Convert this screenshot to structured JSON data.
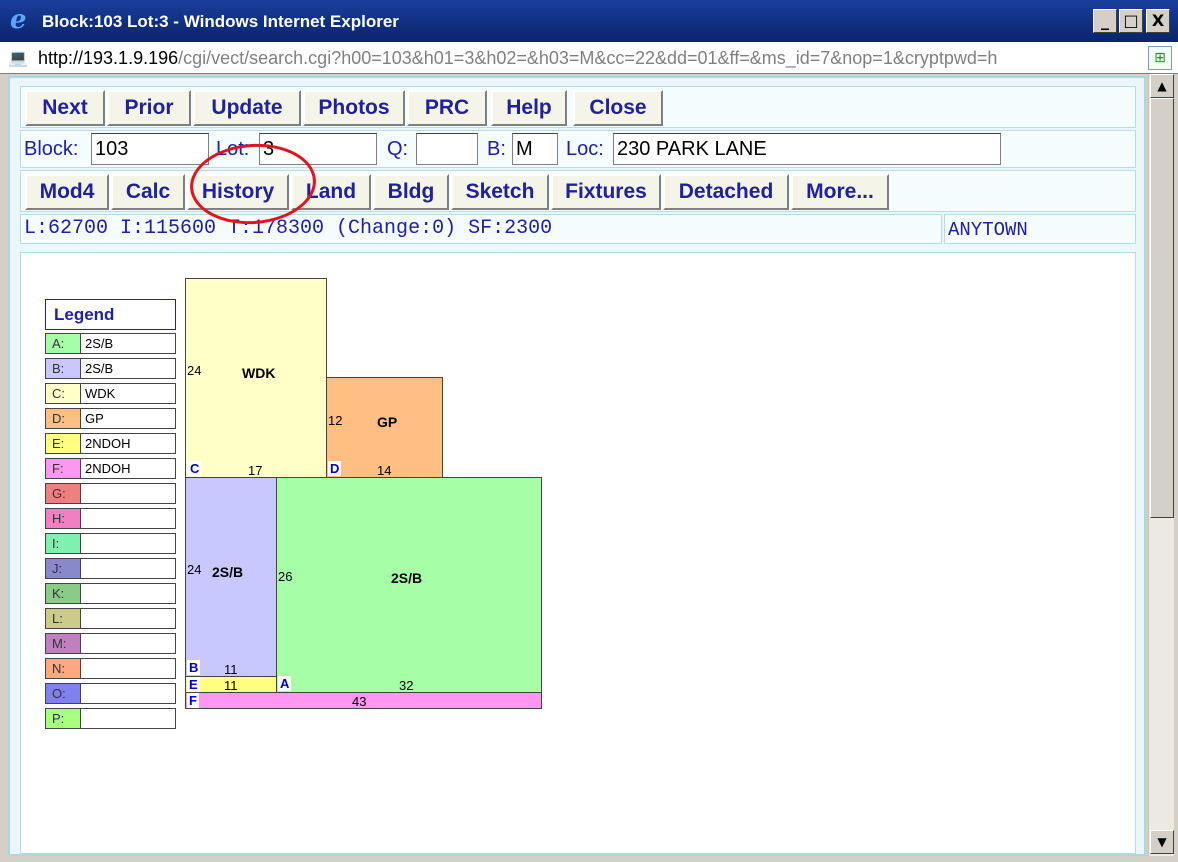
{
  "window": {
    "title": "Block:103 Lot:3 - Windows Internet Explorer",
    "controls": {
      "minimize": "_",
      "maximize": "□",
      "close": "X"
    }
  },
  "address": {
    "host_part": "http://193.1.9.196",
    "path_part": "/cgi/vect/search.cgi?h00=103&h01=3&h02=&h03=M&cc=22&dd=01&ff=&ms_id=7&nop=1&cryptpwd=h"
  },
  "toolbar1": [
    "Next",
    "Prior",
    "Update",
    "Photos",
    "PRC",
    "Help",
    "Close"
  ],
  "search": {
    "block_label": "Block:",
    "block_value": "103",
    "lot_label": "Lot:",
    "lot_value": "3",
    "q_label": "Q:",
    "q_value": "",
    "b_label": "B:",
    "b_value": "M",
    "loc_label": "Loc:",
    "loc_value": "230 PARK LANE"
  },
  "toolbar2": [
    "Mod4",
    "Calc",
    "History",
    "Land",
    "Bldg",
    "Sketch",
    "Fixtures",
    "Detached",
    "More..."
  ],
  "summary": {
    "values": "L:62700 I:115600 T:178300 (Change:0) SF:2300",
    "town": "ANYTOWN"
  },
  "legend": {
    "title": "Legend",
    "items": [
      {
        "key": "A:",
        "value": "2S/B",
        "color": "#a6ffa6"
      },
      {
        "key": "B:",
        "value": "2S/B",
        "color": "#c8c8ff"
      },
      {
        "key": "C:",
        "value": "WDK",
        "color": "#ffffc8"
      },
      {
        "key": "D:",
        "value": "GP",
        "color": "#ffbe82"
      },
      {
        "key": "E:",
        "value": "2NDOH",
        "color": "#ffff82"
      },
      {
        "key": "F:",
        "value": "2NDOH",
        "color": "#ff96f0"
      },
      {
        "key": "G:",
        "value": "",
        "color": "#f08080"
      },
      {
        "key": "H:",
        "value": "",
        "color": "#f080c0"
      },
      {
        "key": "I:",
        "value": "",
        "color": "#80f0b0"
      },
      {
        "key": "J:",
        "value": "",
        "color": "#8888cc"
      },
      {
        "key": "K:",
        "value": "",
        "color": "#88cc88"
      },
      {
        "key": "L:",
        "value": "",
        "color": "#cccc88"
      },
      {
        "key": "M:",
        "value": "",
        "color": "#c080c0"
      },
      {
        "key": "N:",
        "value": "",
        "color": "#ffa880"
      },
      {
        "key": "O:",
        "value": "",
        "color": "#8080f0"
      },
      {
        "key": "P:",
        "value": "",
        "color": "#a8ff80"
      }
    ]
  },
  "sketch": {
    "areas": [
      {
        "id": "C",
        "label": "WDK",
        "side": "24",
        "bottom": "17",
        "color": "#ffffc8"
      },
      {
        "id": "D",
        "label": "GP",
        "side": "12",
        "bottom": "14",
        "color": "#ffbe82"
      },
      {
        "id": "B",
        "label": "2S/B",
        "side": "24",
        "bottom": "11",
        "color": "#c8c8ff"
      },
      {
        "id": "A",
        "label": "2S/B",
        "side": "26",
        "bottom": "32",
        "color": "#a6ffa6"
      },
      {
        "id": "E",
        "label": "",
        "side": "",
        "bottom": "11",
        "color": "#ffff82"
      },
      {
        "id": "F",
        "label": "",
        "side": "",
        "bottom": "43",
        "color": "#ff96f0"
      }
    ]
  },
  "scrollbar": {
    "up": "▲",
    "down": "▼"
  },
  "icons": {
    "ie": "e",
    "page": "💻",
    "compat": "⊞"
  },
  "accent_color": "#2020a0",
  "annotation_color": "#e0141e"
}
